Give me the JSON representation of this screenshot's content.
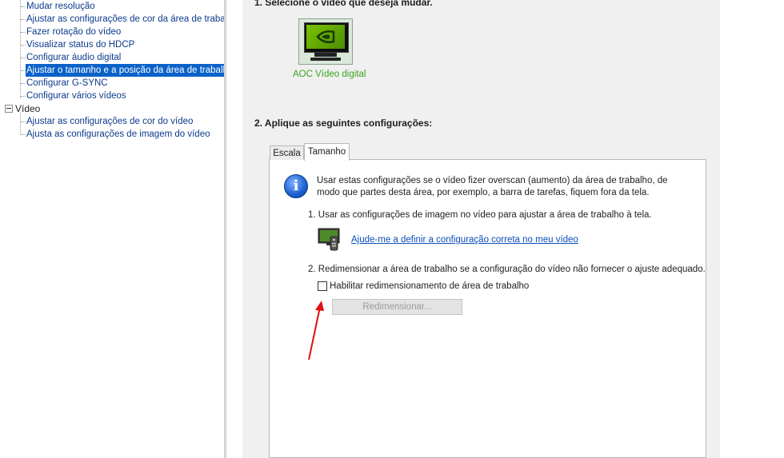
{
  "tree": {
    "items": [
      {
        "label": "Mudar resolução"
      },
      {
        "label": "Ajustar as configurações de cor da área de trabalho"
      },
      {
        "label": "Fazer rotação do vídeo"
      },
      {
        "label": "Visualizar status do HDCP"
      },
      {
        "label": "Configurar áudio digital"
      },
      {
        "label": "Ajustar o tamanho e a posição da área de trabalho",
        "selected": true
      },
      {
        "label": "Configurar G-SYNC"
      },
      {
        "label": "Configurar vários vídeos"
      }
    ],
    "video_group": {
      "label": "Vídeo",
      "items": [
        {
          "label": "Ajustar as configurações de cor do vídeo"
        },
        {
          "label": "Ajusta as configurações de imagem do vídeo"
        }
      ]
    }
  },
  "main": {
    "step1_title": "1. Selecione o vídeo que deseja mudar.",
    "display_label": "AOC Vídeo digital",
    "step2_title": "2. Aplique as seguintes configurações:",
    "tabs": [
      {
        "label": "Escala",
        "active": false
      },
      {
        "label": "Tamanho",
        "active": true
      }
    ],
    "info_text": "Usar estas configurações se o vídeo fizer overscan (aumento) da área de trabalho, de modo que partes desta área, por exemplo, a barra de tarefas, fiquem fora da tela.",
    "option1": "1. Usar as configurações de imagem no vídeo para ajustar a área de trabalho à tela.",
    "help_link": "Ajude-me a definir a configuração correta no meu vídeo",
    "option2": "2. Redimensionar a área de trabalho se a configuração do vídeo não fornecer o ajuste adequado.",
    "checkbox_label": "Habilitar redimensionamento de área de trabalho",
    "checkbox_checked": false,
    "resize_button": "Redimensionar..."
  },
  "colors": {
    "selection": "#0a62c9",
    "link": "#0b4dba",
    "display_label": "#3aa41e",
    "annotation_arrow": "#e01010"
  }
}
